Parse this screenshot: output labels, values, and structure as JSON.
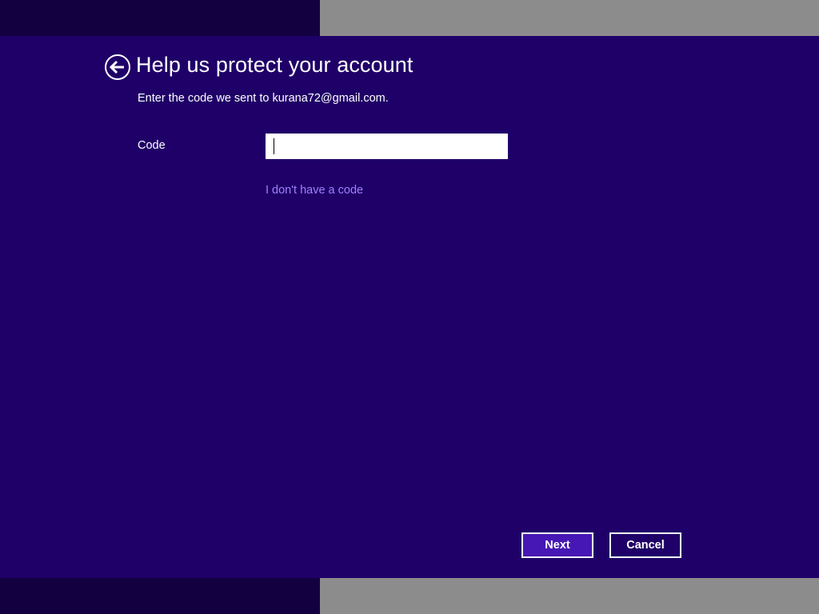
{
  "header": {
    "title": "Help us protect your account",
    "subtitle": "Enter the code we sent to kurana72@gmail.com."
  },
  "form": {
    "code_label": "Code",
    "code_value": "",
    "no_code_link": "I don't have a code"
  },
  "buttons": {
    "next_label": "Next",
    "cancel_label": "Cancel"
  },
  "icons": {
    "back": "back-arrow-circle-icon"
  },
  "colors": {
    "background": "#1f0068",
    "primary_button": "#4617b4",
    "link": "#9f80ff",
    "text": "#ffffff"
  }
}
